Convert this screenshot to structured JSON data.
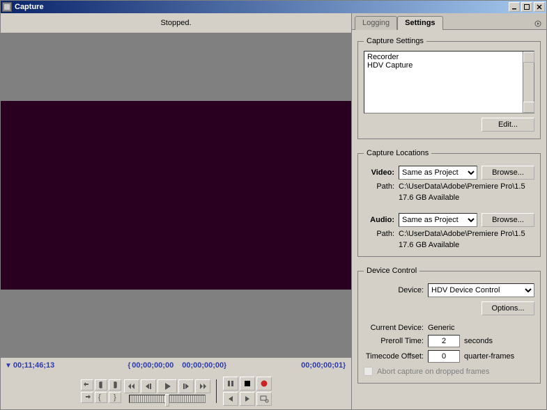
{
  "window": {
    "title": "Capture"
  },
  "status": "Stopped.",
  "timecodes": {
    "current": "00;11;46;13",
    "in": "00;00;00;00",
    "out": "00;00;00;00",
    "duration": "00;00;00;01"
  },
  "tabs": {
    "logging": "Logging",
    "settings": "Settings"
  },
  "capture_settings": {
    "legend": "Capture Settings",
    "items": [
      "Recorder",
      "HDV Capture"
    ],
    "edit": "Edit..."
  },
  "capture_locations": {
    "legend": "Capture Locations",
    "video_label": "Video:",
    "video_select": "Same as Project",
    "browse": "Browse...",
    "path_label": "Path:",
    "video_path": "C:\\UserData\\Adobe\\Premiere Pro\\1.5",
    "video_avail": "17.6 GB Available",
    "audio_label": "Audio:",
    "audio_select": "Same as Project",
    "audio_path": "C:\\UserData\\Adobe\\Premiere Pro\\1.5",
    "audio_avail": "17.6 GB Available"
  },
  "device_control": {
    "legend": "Device Control",
    "device_label": "Device:",
    "device_select": "HDV Device Control",
    "options": "Options...",
    "current_device_label": "Current Device:",
    "current_device": "Generic",
    "preroll_label": "Preroll Time:",
    "preroll_value": "2",
    "preroll_unit": "seconds",
    "offset_label": "Timecode Offset:",
    "offset_value": "0",
    "offset_unit": "quarter-frames",
    "abort_label": "Abort capture on dropped frames"
  }
}
